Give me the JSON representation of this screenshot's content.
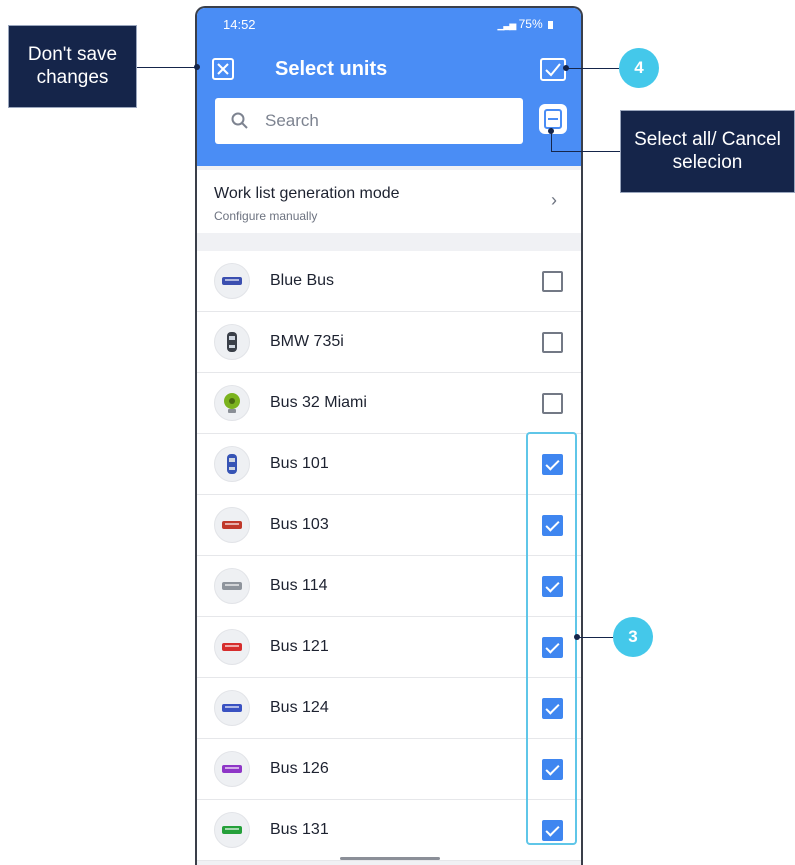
{
  "statusbar": {
    "time": "14:52",
    "battery": "75%"
  },
  "header": {
    "title": "Select units"
  },
  "search": {
    "placeholder": "Search"
  },
  "mode": {
    "title": "Work list generation mode",
    "subtitle": "Configure manually"
  },
  "units": [
    {
      "name": "Blue Bus",
      "checked": false,
      "icon": "blue-bus-icon",
      "color": "#3b4fb0"
    },
    {
      "name": "BMW 735i",
      "checked": false,
      "icon": "car-icon",
      "color": "#3a3f48"
    },
    {
      "name": "Bus 32 Miami",
      "checked": false,
      "icon": "green-marker-icon",
      "color": "#7bb31e"
    },
    {
      "name": "Bus 101",
      "checked": true,
      "icon": "blue-car-icon",
      "color": "#3654b5"
    },
    {
      "name": "Bus 103",
      "checked": true,
      "icon": "red-bus-icon",
      "color": "#c0392b"
    },
    {
      "name": "Bus 114",
      "checked": true,
      "icon": "grey-bus-icon",
      "color": "#8e949c"
    },
    {
      "name": "Bus 121",
      "checked": true,
      "icon": "red-bus-icon",
      "color": "#d62d2d"
    },
    {
      "name": "Bus 124",
      "checked": true,
      "icon": "blue-bus-icon",
      "color": "#3a52c2"
    },
    {
      "name": "Bus 126",
      "checked": true,
      "icon": "purple-bus-icon",
      "color": "#8e36c7"
    },
    {
      "name": "Bus 131",
      "checked": true,
      "icon": "green-bus-icon",
      "color": "#25a03a"
    }
  ],
  "annotations": {
    "dont_save": "Don't save changes",
    "select_all": "Select all/ Cancel selecion",
    "badge_4": "4",
    "badge_3": "3"
  },
  "colors": {
    "accent": "#4a8df5",
    "checkbox": "#3f86f0",
    "callout": "#15254a",
    "badge": "#44c8ea"
  }
}
